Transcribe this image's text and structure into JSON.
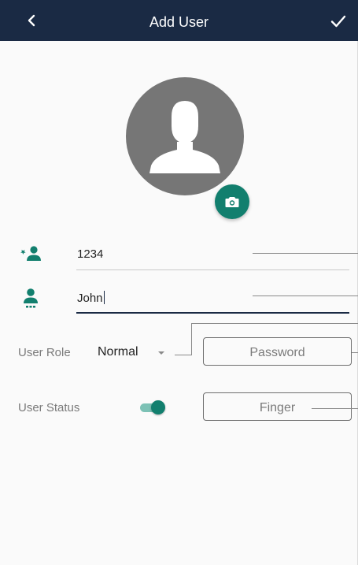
{
  "app_bar": {
    "title": "Add User",
    "back_icon": "chevron-left-icon",
    "confirm_icon": "check-icon",
    "background_color": "#1a2a44"
  },
  "avatar": {
    "placeholder_icon": "person-silhouette-icon",
    "camera_icon": "camera-icon",
    "accent_color": "#127f6e"
  },
  "fields": {
    "user_id": {
      "icon": "user-id-icon",
      "value": "1234"
    },
    "user_name": {
      "icon": "user-name-icon",
      "value": "John"
    }
  },
  "user_role": {
    "label": "User Role",
    "selected": "Normal"
  },
  "user_status": {
    "label": "User Status",
    "enabled": true
  },
  "buttons": {
    "password": "Password",
    "finger": "Finger"
  }
}
